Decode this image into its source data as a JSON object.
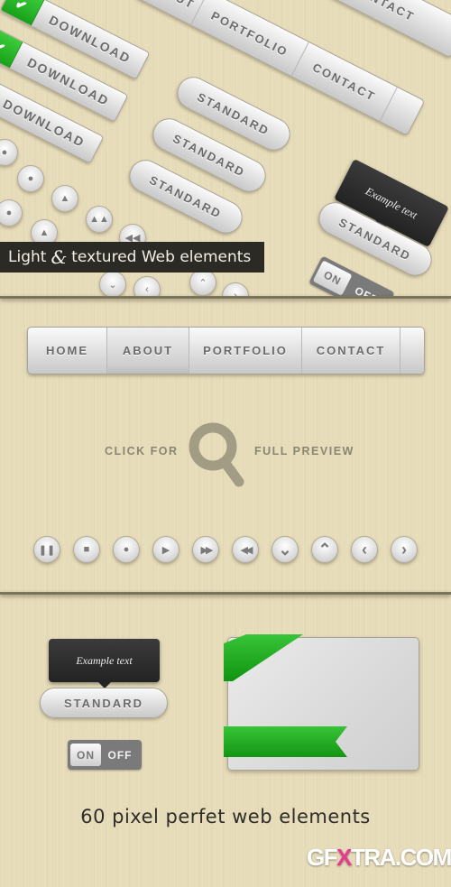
{
  "showcase": {
    "download_buttons": [
      {
        "label": "DOWNLOAD",
        "icon": "check-icon"
      },
      {
        "label": "DOWNLOAD",
        "icon": "check-icon"
      },
      {
        "label": "DOWNLOAD",
        "icon": "check-icon"
      }
    ],
    "rotated_nav_top": [
      "ABOUT",
      "PORTFOLIO",
      "CONTACT"
    ],
    "rotated_nav_contact": "CONTACT",
    "standard_buttons": [
      "STANDARD",
      "STANDARD",
      "STANDARD"
    ],
    "tooltip": {
      "text": "Example text",
      "button": "STANDARD"
    },
    "toggle": {
      "on": "ON",
      "off": "OFF"
    },
    "caption": {
      "part1": "Light",
      "amp": "&",
      "part2": "textured Web elements"
    }
  },
  "nav": {
    "items": [
      {
        "label": "HOME",
        "active": false
      },
      {
        "label": "ABOUT",
        "active": true
      },
      {
        "label": "PORTFOLIO",
        "active": false
      },
      {
        "label": "CONTACT",
        "active": false
      }
    ]
  },
  "preview": {
    "left": "CLICK FOR",
    "right": "FULL PREVIEW",
    "icon": "magnifier-icon"
  },
  "media_buttons": [
    {
      "name": "pause-icon",
      "glyph": "❚❚"
    },
    {
      "name": "stop-icon",
      "glyph": "■"
    },
    {
      "name": "record-icon",
      "glyph": "●"
    },
    {
      "name": "play-icon",
      "glyph": "▶"
    },
    {
      "name": "fast-forward-icon",
      "glyph": "▶▶"
    },
    {
      "name": "rewind-icon",
      "glyph": "◀◀"
    },
    {
      "name": "chevron-down-icon",
      "glyph": "⌄"
    },
    {
      "name": "chevron-up-icon",
      "glyph": "⌃"
    },
    {
      "name": "chevron-left-icon",
      "glyph": "‹"
    },
    {
      "name": "chevron-right-icon",
      "glyph": "›"
    }
  ],
  "bottom": {
    "tooltip": {
      "text": "Example text"
    },
    "standard_button": "STANDARD",
    "toggle": {
      "on": "ON",
      "off": "OFF"
    },
    "tagline": "60 pixel perfet web elements",
    "watermark": {
      "a": "GF",
      "x": "X",
      "b": "TRA.COM"
    }
  },
  "colors": {
    "background": "#e6dcba",
    "green": "#1fae1f",
    "dark": "#2b2a25",
    "silver_text": "#6b6b6b",
    "preview_text": "#8b8672"
  }
}
